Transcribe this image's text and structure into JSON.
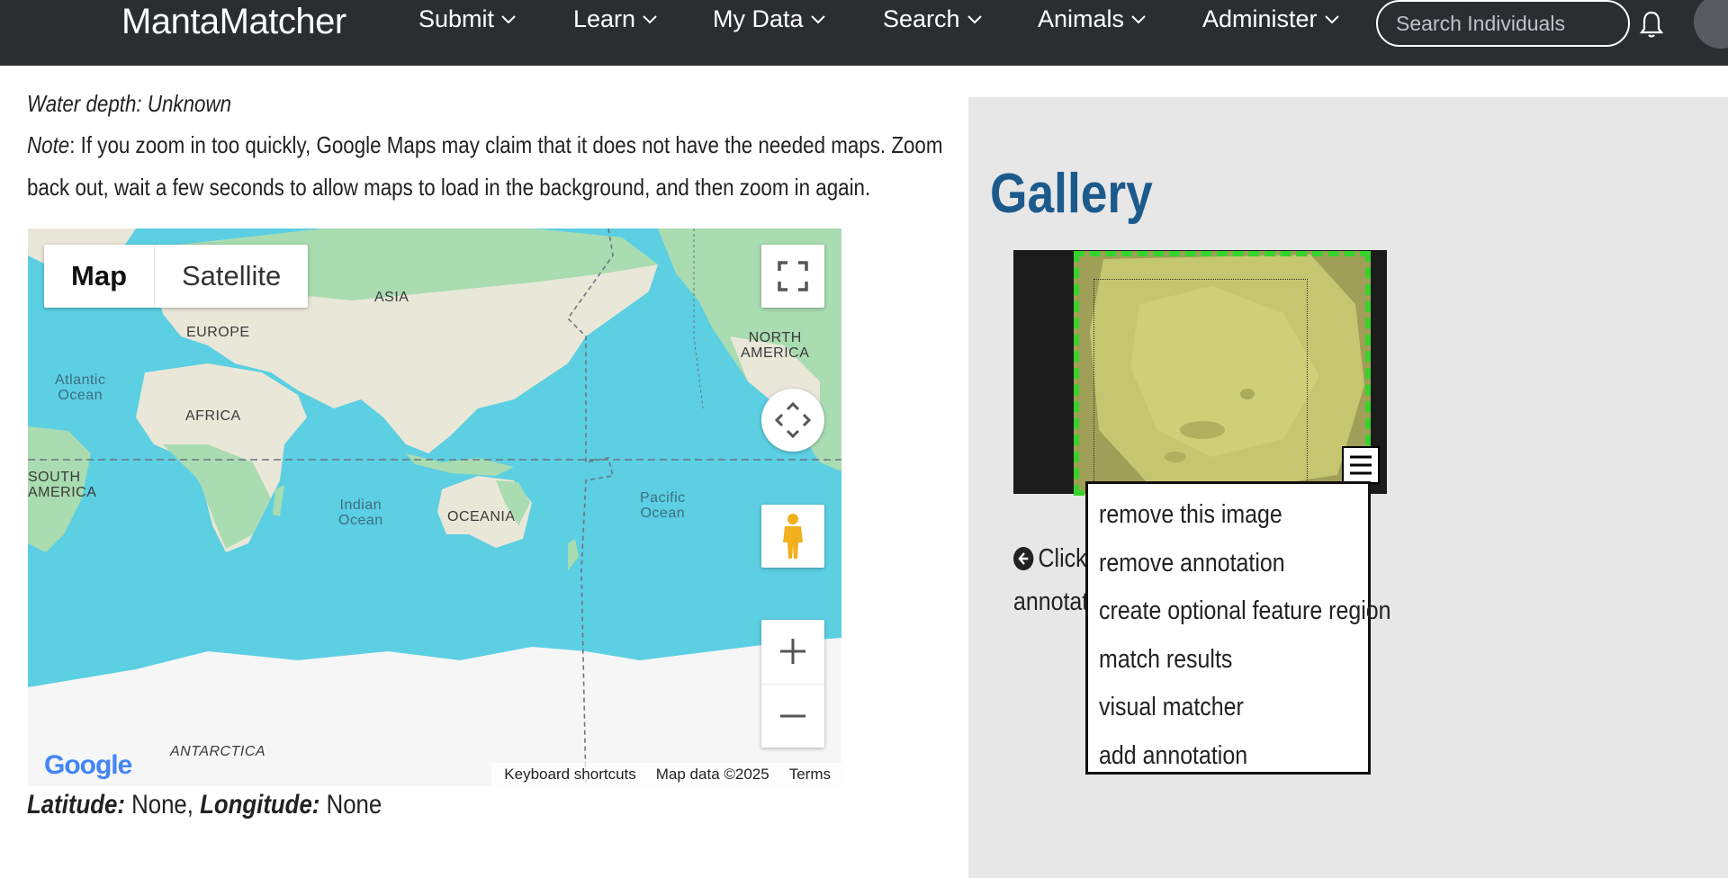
{
  "navbar": {
    "brand": "MantaMatcher",
    "items": [
      {
        "label": "Submit"
      },
      {
        "label": "Learn"
      },
      {
        "label": "My Data"
      },
      {
        "label": "Search"
      },
      {
        "label": "Animals"
      },
      {
        "label": "Administer"
      }
    ],
    "search_placeholder": "Search Individuals"
  },
  "location": {
    "water_depth": "Water depth: Unknown",
    "note_prefix": "Note",
    "note_line1": ": If you zoom in too quickly, Google Maps may claim that it does not have the needed maps. Zoom",
    "note_line2": "back out, wait a few seconds to allow maps to load in the background, and then zoom in again.",
    "latitude_label": "Latitude:",
    "latitude_value": "None,",
    "longitude_label": "Longitude:",
    "longitude_value": "None"
  },
  "map": {
    "type_buttons": [
      "Map",
      "Satellite"
    ],
    "active_type": "Map",
    "labels": {
      "asia": "ASIA",
      "europe": "EUROPE",
      "north_america_1": "NORTH",
      "north_america_2": "AMERICA",
      "atlantic_1": "Atlantic",
      "atlantic_2": "Ocean",
      "africa": "AFRICA",
      "south_america_1": "SOUTH",
      "south_america_2": "AMERICA",
      "indian_1": "Indian",
      "indian_2": "Ocean",
      "oceania": "OCEANIA",
      "pacific_1": "Pacific",
      "pacific_2": "Ocean",
      "antarctica": "ANTARCTICA"
    },
    "footer": {
      "shortcuts": "Keyboard shortcuts",
      "data": "Map data ©2025",
      "terms": "Terms"
    },
    "logo": "Google"
  },
  "gallery": {
    "title": "Gallery",
    "menu_items": [
      "remove this image",
      "remove annotation",
      "create optional feature region",
      "match results",
      "visual matcher",
      "add annotation"
    ],
    "hint_line1": "Click",
    "hint_line2": "annotati"
  },
  "colors": {
    "navbar_bg": "#2b2e31",
    "gallery_title": "#1c5a8c",
    "annotation_border": "#36d32b",
    "panel_bg": "#e7e7e7",
    "water": "#5ccfe2"
  }
}
